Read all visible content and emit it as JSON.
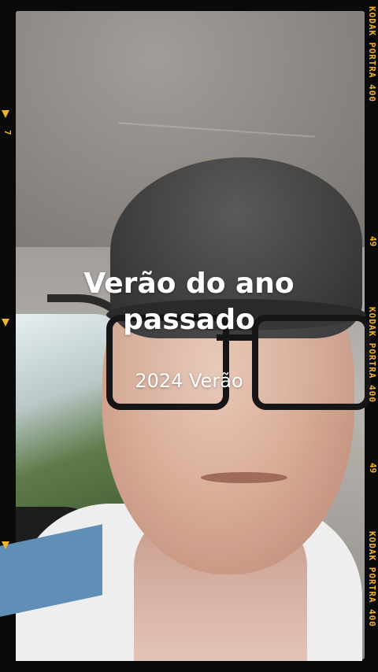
{
  "overlay": {
    "title": "Verão do ano passado",
    "subtitle": "2024 Verão"
  },
  "film_border": {
    "brand_labels": [
      "KODAK PORTRA 400",
      "KODAK PORTRA 400",
      "KODAK PORTRA 400"
    ],
    "frame_numbers": [
      "49",
      "49"
    ],
    "left_number": "7",
    "accent_color": "#f0b429"
  },
  "icons": {
    "frame_arrow": "triangle-down-icon"
  }
}
